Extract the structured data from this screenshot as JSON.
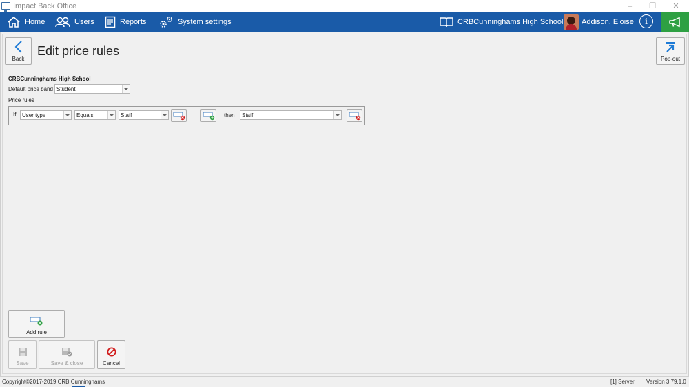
{
  "window": {
    "title": "Impact Back Office",
    "minimize": "–",
    "restore": "❐",
    "close": "✕"
  },
  "nav": {
    "home": "Home",
    "users": "Users",
    "reports": "Reports",
    "system_settings": "System settings",
    "school": "CRBCunninghams High School",
    "user_name": "Addison, Eloise",
    "info": "i"
  },
  "header": {
    "back_label": "Back",
    "title": "Edit price rules",
    "popout_label": "Pop-out"
  },
  "form": {
    "school_name": "CRBCunninghams High School",
    "default_band_label": "Default price band",
    "default_band_value": "Student",
    "price_rules_label": "Price rules"
  },
  "rule": {
    "if_label": "If",
    "field_value": "User type",
    "operator_value": "Equals",
    "compare_value": "Staff",
    "then_label": "then",
    "result_value": "Staff"
  },
  "actions": {
    "add_rule": "Add rule",
    "save": "Save",
    "save_close": "Save & close",
    "cancel": "Cancel"
  },
  "status": {
    "copyright": "Copyright©2017-2019 CRB Cunninghams",
    "server": "[1] Server",
    "version": "Version 3.79.1.0"
  },
  "colors": {
    "navbar": "#1a5ba8",
    "announce": "#2ea043",
    "cancel_red": "#d11a1a",
    "back_blue": "#1e7bd6"
  }
}
